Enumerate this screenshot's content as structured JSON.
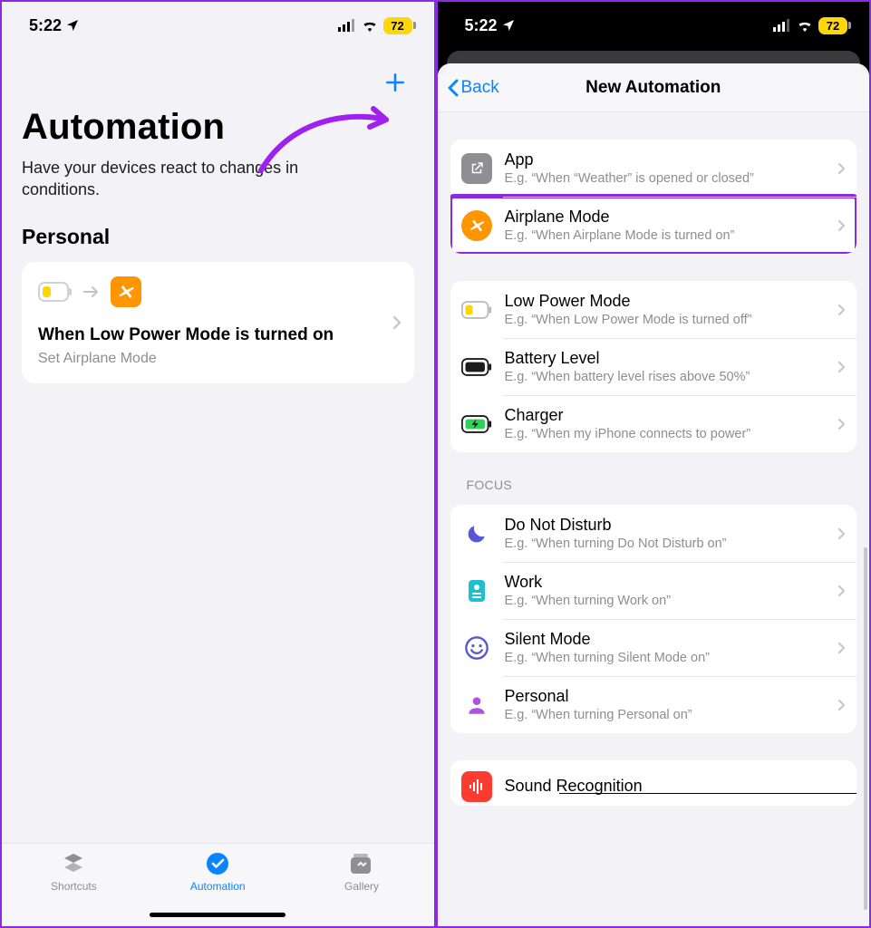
{
  "status": {
    "time": "5:22",
    "battery": "72"
  },
  "left": {
    "title": "Automation",
    "subtitle": "Have your devices react to changes in conditions.",
    "section": "Personal",
    "card": {
      "title": "When Low Power Mode is turned on",
      "subtitle": "Set Airplane Mode"
    },
    "tabs": {
      "shortcuts": "Shortcuts",
      "automation": "Automation",
      "gallery": "Gallery"
    }
  },
  "right": {
    "back": "Back",
    "title": "New Automation",
    "group1": [
      {
        "title": "App",
        "sub": "E.g. “When “Weather” is opened or closed”"
      },
      {
        "title": "Airplane Mode",
        "sub": "E.g. “When Airplane Mode is turned on”"
      }
    ],
    "group2": [
      {
        "title": "Low Power Mode",
        "sub": "E.g. “When Low Power Mode is turned off”"
      },
      {
        "title": "Battery Level",
        "sub": "E.g. “When battery level rises above 50%”"
      },
      {
        "title": "Charger",
        "sub": "E.g. “When my iPhone connects to power”"
      }
    ],
    "focusHeader": "FOCUS",
    "group3": [
      {
        "title": "Do Not Disturb",
        "sub": "E.g. “When turning Do Not Disturb on”"
      },
      {
        "title": "Work",
        "sub": "E.g. “When turning Work on”"
      },
      {
        "title": "Silent Mode",
        "sub": "E.g. “When turning Silent Mode  on”"
      },
      {
        "title": "Personal",
        "sub": "E.g. “When turning Personal on”"
      }
    ],
    "group4": [
      {
        "title": "Sound Recognition"
      }
    ]
  }
}
